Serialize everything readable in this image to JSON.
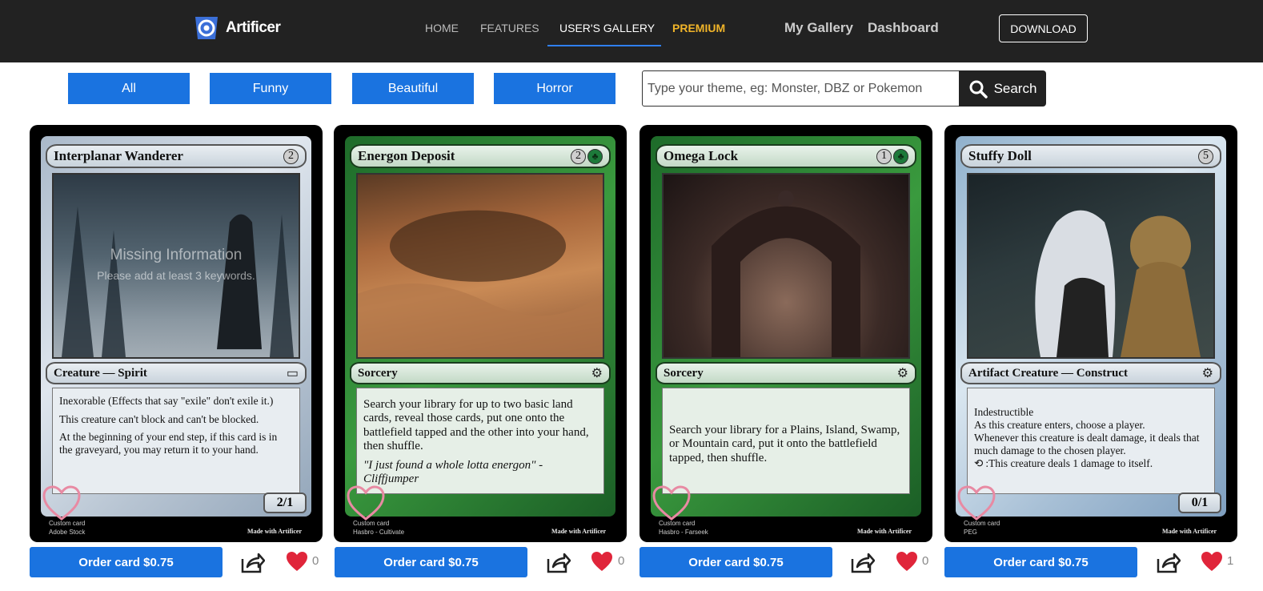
{
  "app": {
    "name": "Artificer"
  },
  "nav": {
    "links": [
      {
        "label": "HOME"
      },
      {
        "label": "FEATURES"
      },
      {
        "label": "USER'S GALLERY"
      },
      {
        "label": "PREMIUM"
      }
    ],
    "my_gallery": "My Gallery",
    "dashboard": "Dashboard",
    "download": "DOWNLOAD"
  },
  "filters": [
    "All",
    "Funny",
    "Beautiful",
    "Horror"
  ],
  "search": {
    "placeholder": "Type your theme, eg: Monster, DBZ or Pokemon",
    "button_label": "Search"
  },
  "colors": {
    "accent": "#1a73e0",
    "premium": "#f0b429",
    "nav_bg": "#222222"
  },
  "cards": [
    {
      "title": "Interplanar Wanderer",
      "cost": [
        "2"
      ],
      "type_line": "Creature — Spirit",
      "rules": [
        "Inexorable (Effects that say \"exile\" don't exile it.)",
        "This creature can't block and can't be blocked.",
        "At the beginning of your end step, if this card is in the graveyard, you may return it to your hand."
      ],
      "flavor": "",
      "pt": "2/1",
      "overlay_title": "Missing Information",
      "overlay_sub": "Please add at least 3 keywords.",
      "footer_left_1": "Custom card",
      "footer_left_2": "Adobe Stock",
      "footer_right": "Made with Artificer",
      "order_label": "Order card $0.75",
      "likes": "0"
    },
    {
      "title": "Energon Deposit",
      "cost": [
        "2",
        "G"
      ],
      "type_line": "Sorcery",
      "rules": [
        "Search your library for up to two basic land cards, reveal those cards, put one onto the battlefield tapped and the other into your hand, then shuffle."
      ],
      "flavor": "\"I just found a whole lotta energon\" - Cliffjumper",
      "pt": "",
      "footer_left_1": "Custom card",
      "footer_left_2": "Hasbro - Cultivate",
      "footer_right": "Made with Artificer",
      "order_label": "Order card $0.75",
      "likes": "0"
    },
    {
      "title": "Omega Lock",
      "cost": [
        "1",
        "G"
      ],
      "type_line": "Sorcery",
      "rules": [
        "Search your library for a Plains, Island, Swamp, or Mountain card, put it onto the battlefield tapped, then shuffle."
      ],
      "flavor": "",
      "pt": "",
      "footer_left_1": "Custom card",
      "footer_left_2": "Hasbro - Farseek",
      "footer_right": "Made with Artificer",
      "order_label": "Order card $0.75",
      "likes": "0"
    },
    {
      "title": "Stuffy Doll",
      "cost": [
        "5"
      ],
      "type_line": "Artifact Creature — Construct",
      "rules": [
        "Indestructible",
        "As this creature enters, choose a player.",
        "Whenever this creature is dealt damage, it deals that much damage to the chosen player.",
        ":This creature deals 1 damage to itself."
      ],
      "flavor": "",
      "pt": "0/1",
      "footer_left_1": "Custom card",
      "footer_left_2": "PEG",
      "footer_right": "Made with Artificer",
      "order_label": "Order card $0.75",
      "likes": "1"
    }
  ]
}
